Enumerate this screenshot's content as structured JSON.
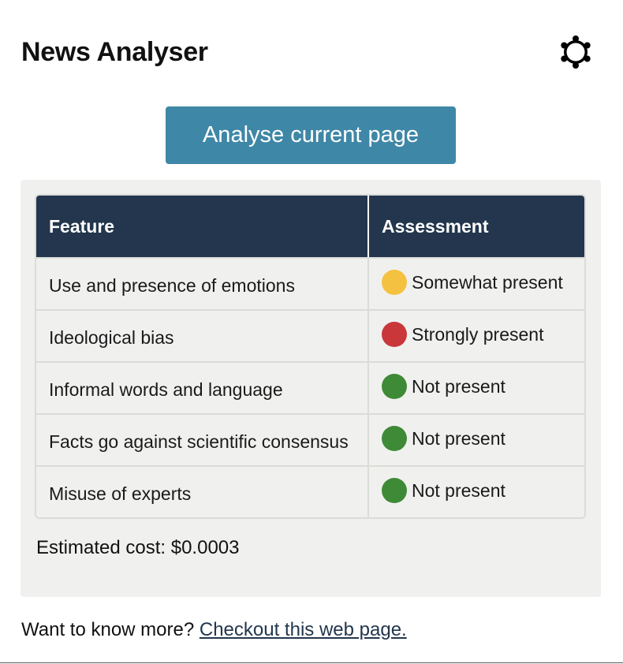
{
  "header": {
    "title": "News Analyser",
    "settings_icon": "gear-icon"
  },
  "actions": {
    "analyse_label": "Analyse current page",
    "analyse_color": "#3f87a6"
  },
  "results": {
    "columns": [
      "Feature",
      "Assessment"
    ],
    "rows": [
      {
        "feature": "Use and presence of emotions",
        "assessment": "Somewhat present",
        "status_color": "#f5c140"
      },
      {
        "feature": "Ideological bias",
        "assessment": "Strongly present",
        "status_color": "#c9373a"
      },
      {
        "feature": "Informal words and language",
        "assessment": "Not present",
        "status_color": "#3f8a36"
      },
      {
        "feature": "Facts go against scientific consensus",
        "assessment": "Not present",
        "status_color": "#3f8a36"
      },
      {
        "feature": "Misuse of experts",
        "assessment": "Not present",
        "status_color": "#3f8a36"
      }
    ],
    "cost_label": "Estimated cost: $0.0003",
    "header_color": "#23364d"
  },
  "footer": {
    "prompt": "Want to know more?",
    "link_label": "Checkout this web page."
  }
}
